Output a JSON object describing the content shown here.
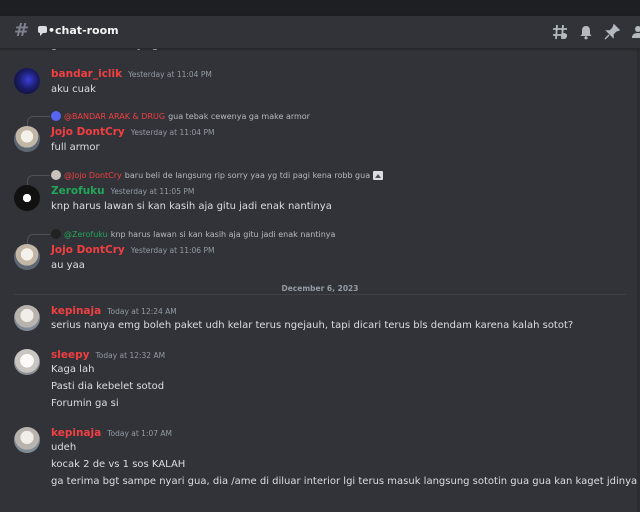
{
  "header": {
    "channel": "•chat-room",
    "icons": [
      "threads-icon",
      "bell-icon",
      "pin-icon",
      "members-icon"
    ]
  },
  "top_partial_text": "gua tebak cewenya ga make armor",
  "messages": [
    {
      "user": "bandar_iclik",
      "color": "#f23f42",
      "time": "Yesterday at 11:04 PM",
      "lines": [
        "aku cuak"
      ]
    },
    {
      "reply_to": "@BANDAR ARAK & DRUG",
      "reply_text": "gua tebak cewenya ga make armor",
      "user": "Jojo DontCry",
      "time": "Yesterday at 11:04 PM",
      "lines": [
        "full armor"
      ]
    },
    {
      "reply_to": "@Jojo DontCry",
      "reply_text": "baru beli de langsung rip sorry yaa yg tdi pagi kena robb gua",
      "user": "Zerofuku",
      "time": "Yesterday at 11:05 PM",
      "lines": [
        "knp harus lawan si kan kasih aja gitu jadi enak nantinya"
      ]
    },
    {
      "reply_to": "@Zerofuku",
      "reply_text": "knp harus lawan si kan kasih aja gitu jadi enak nantinya",
      "user": "Jojo DontCry",
      "time": "Yesterday at 11:06 PM",
      "lines": [
        "au yaa"
      ]
    },
    {
      "user": "kepinaja",
      "time": "Today at 12:24 AM",
      "lines": [
        "serius nanya emg boleh paket udh kelar terus ngejauh, tapi dicari terus bls dendam karena kalah sotot?"
      ]
    },
    {
      "user": "sleepy",
      "time": "Today at 12:32 AM",
      "lines": [
        "Kaga lah",
        "Pasti dia kebelet sotod",
        "Forumin ga si"
      ]
    },
    {
      "user": "kepinaja",
      "time": "Today at 1:07 AM",
      "lines": [
        "udeh",
        "kocak 2 de vs 1 sos KALAH",
        "ga terima bgt sampe nyari gua, dia /ame di diluar interior lgi terus masuk langsung sototin gua gua kan kaget jdinya ajg"
      ]
    }
  ],
  "date_divider": "December 6, 2023"
}
